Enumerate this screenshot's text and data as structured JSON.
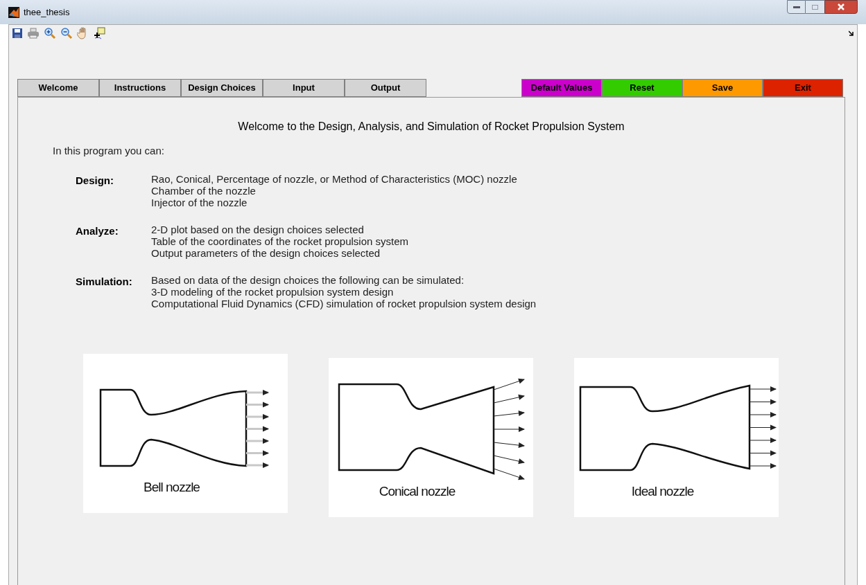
{
  "window": {
    "title": "thee_thesis"
  },
  "toolbar": {
    "tools": [
      {
        "kind": "save"
      },
      {
        "kind": "print"
      },
      {
        "kind": "zoom-in"
      },
      {
        "kind": "zoom-out"
      },
      {
        "kind": "pan"
      },
      {
        "kind": "data-cursor"
      }
    ]
  },
  "tabs": [
    {
      "label": "Welcome"
    },
    {
      "label": "Instructions"
    },
    {
      "label": "Design Choices"
    },
    {
      "label": "Input"
    },
    {
      "label": "Output"
    }
  ],
  "actions": [
    {
      "label": "Default Values",
      "color": "#cc00cc"
    },
    {
      "label": "Reset",
      "color": "#33cc00"
    },
    {
      "label": "Save",
      "color": "#ff9900"
    },
    {
      "label": "Exit",
      "color": "#dd2200"
    }
  ],
  "heading": "Welcome to the Design, Analysis, and Simulation of Rocket Propulsion System",
  "intro": "In this program you can:",
  "sections": [
    {
      "label": "Design:",
      "lines": [
        "Rao, Conical, Percentage of nozzle, or Method of Characteristics (MOC) nozzle",
        "Chamber of the nozzle",
        "Injector of the nozzle"
      ]
    },
    {
      "label": "Analyze:",
      "lines": [
        "2-D plot based on the design choices selected",
        "Table of the coordinates of the rocket propulsion system",
        "Output parameters of the design choices selected"
      ]
    },
    {
      "label": "Simulation:",
      "lines": [
        "Based on data of the design choices the following can be simulated:",
        "3-D modeling of the rocket propulsion system design",
        "Computational Fluid Dynamics (CFD) simulation of rocket propulsion system design"
      ]
    }
  ],
  "figures": [
    {
      "kind": "bell",
      "caption": "Bell nozzle"
    },
    {
      "kind": "conical",
      "caption": "Conical nozzle"
    },
    {
      "kind": "ideal",
      "caption": "Ideal nozzle"
    }
  ]
}
